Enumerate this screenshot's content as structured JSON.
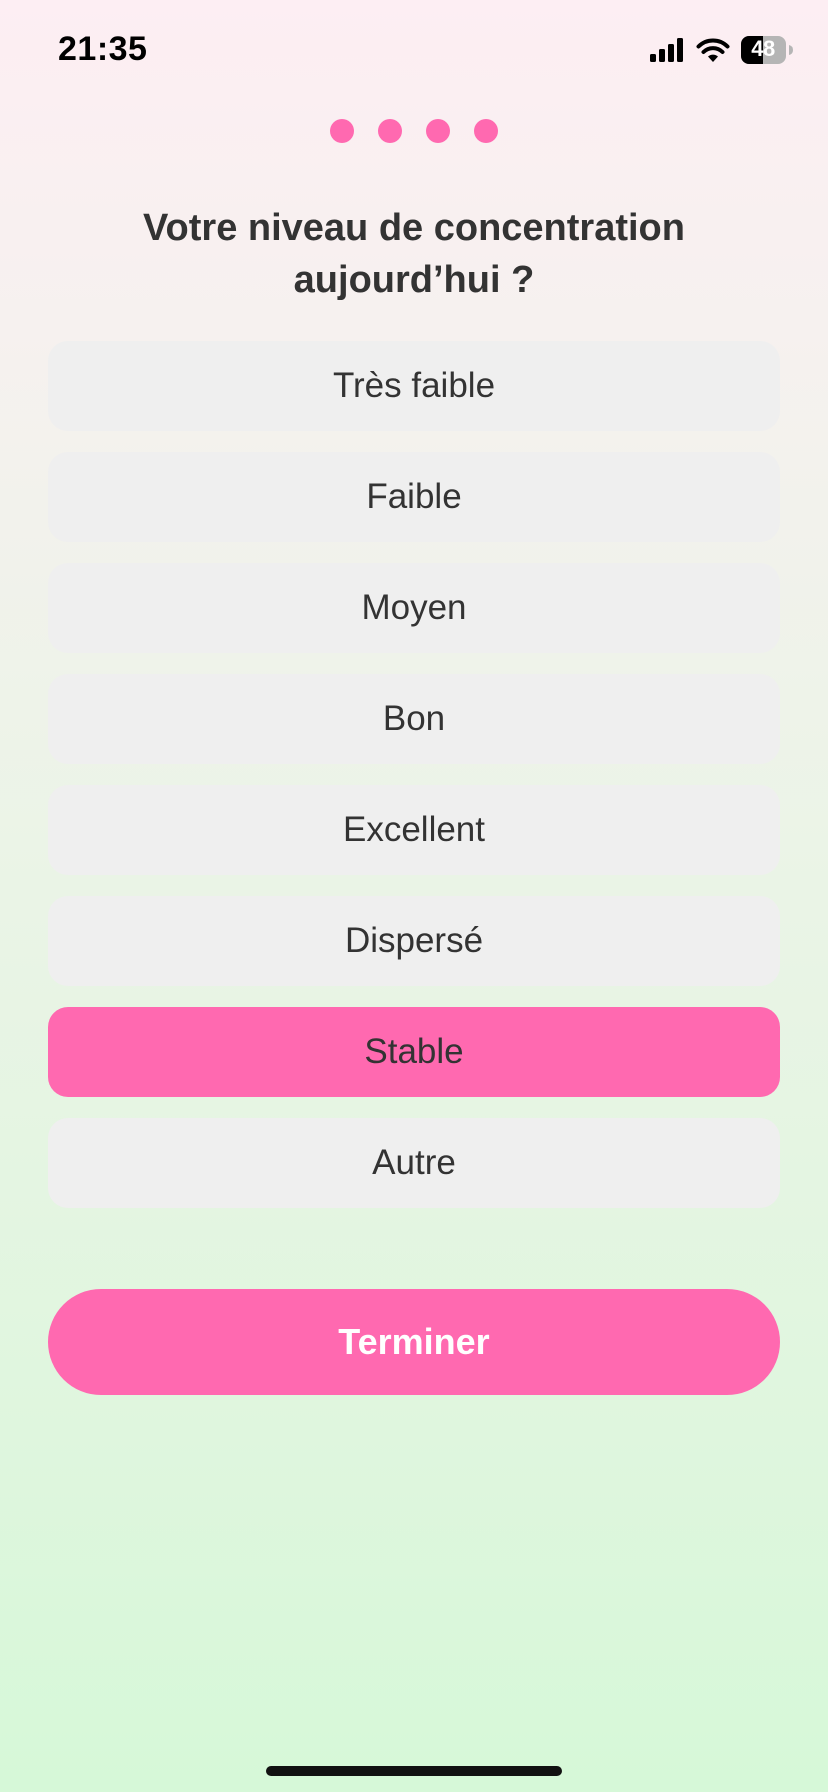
{
  "status_bar": {
    "time": "21:35",
    "battery": "48",
    "icons": [
      "signal-icon",
      "wifi-icon",
      "battery-icon"
    ]
  },
  "progress": {
    "steps": 4,
    "icon": "dot"
  },
  "question": {
    "title": "Votre niveau de concentration aujourd’hui ?"
  },
  "options": [
    {
      "label": "Très faible",
      "selected": false
    },
    {
      "label": "Faible",
      "selected": false
    },
    {
      "label": "Moyen",
      "selected": false
    },
    {
      "label": "Bon",
      "selected": false
    },
    {
      "label": "Excellent",
      "selected": false
    },
    {
      "label": "Dispersé",
      "selected": false
    },
    {
      "label": "Stable",
      "selected": true
    },
    {
      "label": "Autre",
      "selected": false
    }
  ],
  "actions": {
    "finish_label": "Terminer"
  },
  "colors": {
    "accent": "#ff69b0",
    "option_bg": "#efefef",
    "text": "#333333"
  }
}
